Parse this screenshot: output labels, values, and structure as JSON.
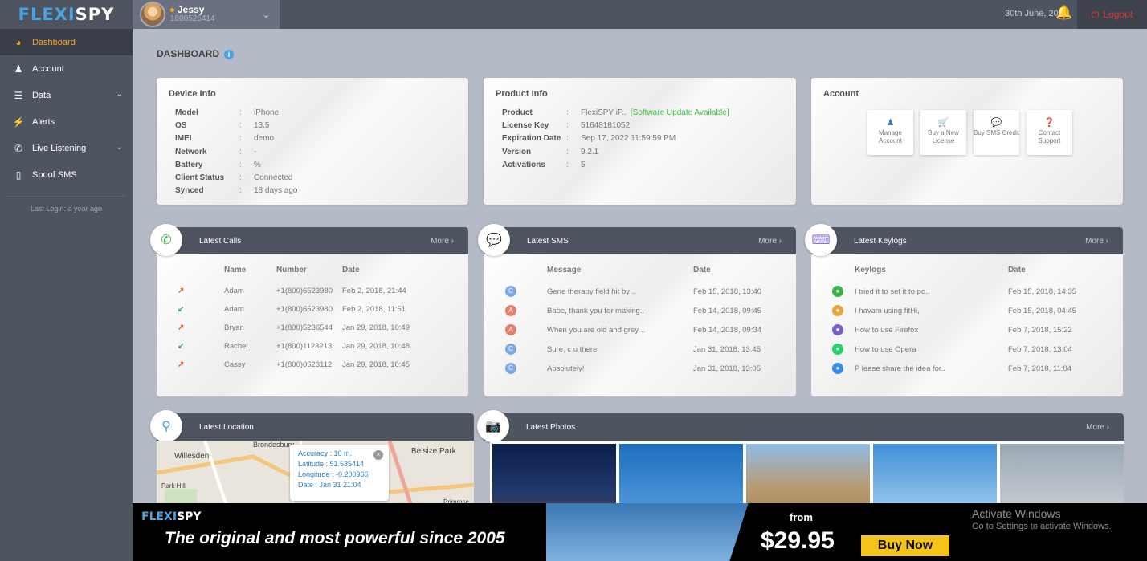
{
  "app": {
    "logo_part1": "FLEXI",
    "logo_part2": "SPY"
  },
  "user": {
    "name": "Jessy",
    "phone": "1800525414"
  },
  "header": {
    "date": "30th June, 2022",
    "logout": "Logout"
  },
  "sidebar": {
    "items": [
      {
        "label": "Dashboard",
        "icon": "dashboard-icon"
      },
      {
        "label": "Account",
        "icon": "user-icon"
      },
      {
        "label": "Data",
        "icon": "database-icon"
      },
      {
        "label": "Alerts",
        "icon": "bolt-icon"
      },
      {
        "label": "Live Listening",
        "icon": "phone-wave-icon"
      },
      {
        "label": "Spoof SMS",
        "icon": "sms-spoof-icon"
      }
    ],
    "last_login": "Last Login: a year ago"
  },
  "page": {
    "title": "DASHBOARD"
  },
  "device_info": {
    "title": "Device Info",
    "rows": [
      {
        "k": "Model",
        "v": "iPhone"
      },
      {
        "k": "OS",
        "v": "13.5"
      },
      {
        "k": "IMEI",
        "v": "demo"
      },
      {
        "k": "Network",
        "v": "-"
      },
      {
        "k": "Battery",
        "v": "%"
      },
      {
        "k": "Client Status",
        "v": "Connected"
      },
      {
        "k": "Synced",
        "v": "18 days ago"
      }
    ]
  },
  "product_info": {
    "title": "Product Info",
    "rows": [
      {
        "k": "Product",
        "v": "FlexiSPY iP.."
      },
      {
        "k": "License Key",
        "v": "51648181052"
      },
      {
        "k": "Expiration Date",
        "v": "Sep 17, 2022 11:59:59 PM"
      },
      {
        "k": "Version",
        "v": "9.2.1"
      },
      {
        "k": "Activations",
        "v": "5"
      }
    ],
    "update": "[Software Update Available]"
  },
  "account": {
    "title": "Account",
    "buttons": [
      "Manage Account",
      "Buy a New License",
      "Buy SMS Credit",
      "Contact Support"
    ]
  },
  "more": "More",
  "calls": {
    "title": "Latest Calls",
    "headers": [
      "Name",
      "Number",
      "Date"
    ],
    "rows": [
      {
        "dir": "out",
        "name": "Adam",
        "number": "+1(800)6523980",
        "date": "Feb 2, 2018, 21:44"
      },
      {
        "dir": "in",
        "name": "Adam",
        "number": "+1(800)6523980",
        "date": "Feb 2, 2018, 11:51"
      },
      {
        "dir": "out",
        "name": "Bryan",
        "number": "+1(800)5236544",
        "date": "Jan 29, 2018, 10:49"
      },
      {
        "dir": "in",
        "name": "Rachel",
        "number": "+1(800)1123213",
        "date": "Jan 29, 2018, 10:48"
      },
      {
        "dir": "out",
        "name": "Cassy",
        "number": "+1(800)0623112",
        "date": "Jan 29, 2018, 10:45"
      }
    ]
  },
  "sms": {
    "title": "Latest SMS",
    "headers": [
      "Message",
      "Date"
    ],
    "rows": [
      {
        "badge": "C",
        "color": "#7fa8e0",
        "msg": "Gene therapy field hit by ..",
        "date": "Feb 15, 2018, 13:40"
      },
      {
        "badge": "A",
        "color": "#e57f6e",
        "msg": "Babe, thank you for making..",
        "date": "Feb 14, 2018, 09:45"
      },
      {
        "badge": "A",
        "color": "#e57f6e",
        "msg": "When you are old and grey ..",
        "date": "Feb 14, 2018, 09:34"
      },
      {
        "badge": "C",
        "color": "#7fa8e0",
        "msg": "Sure, c u there",
        "date": "Jan 31, 2018, 13:45"
      },
      {
        "badge": "C",
        "color": "#7fa8e0",
        "msg": "Absolutely!",
        "date": "Jan 31, 2018, 13:05"
      }
    ]
  },
  "keylogs": {
    "title": "Latest Keylogs",
    "headers": [
      "Keylogs",
      "Date"
    ],
    "rows": [
      {
        "app": "line",
        "color": "#39b54a",
        "text": "I tried it to set it to po..",
        "date": "Feb 15, 2018, 14:35"
      },
      {
        "app": "chrome",
        "color": "#e8a33b",
        "text": "I havam using fitHi,",
        "date": "Feb 15, 2018, 04:45"
      },
      {
        "app": "viber",
        "color": "#7b5fc7",
        "text": "How to use Firefox",
        "date": "Feb 7, 2018, 15:22"
      },
      {
        "app": "whatsapp",
        "color": "#25d366",
        "text": "How to use Opera",
        "date": "Feb 7, 2018, 13:04"
      },
      {
        "app": "messenger",
        "color": "#2f8ef0",
        "text": "P lease share the idea for..",
        "date": "Feb 7, 2018, 11:04"
      }
    ]
  },
  "location": {
    "title": "Latest Location",
    "accuracy": "Accuracy : 10 m.",
    "latitude": "Latitude : 51.535414",
    "longitude": "Longitude : -0.200966",
    "date": "Date : Jan 31 21:04",
    "places": [
      "Willesden",
      "Belsize Park",
      "Park Hill",
      "Brondesbury",
      "Primrose"
    ]
  },
  "photos": {
    "title": "Latest Photos"
  },
  "ad": {
    "logo1": "FLEXI",
    "logo2": "SPY",
    "tagline": "The original and most powerful since 2005",
    "from": "from",
    "price": "$29.95",
    "buy": "Buy Now"
  },
  "watermark": {
    "line1": "Activate Windows",
    "line2": "Go to Settings to activate Windows."
  }
}
